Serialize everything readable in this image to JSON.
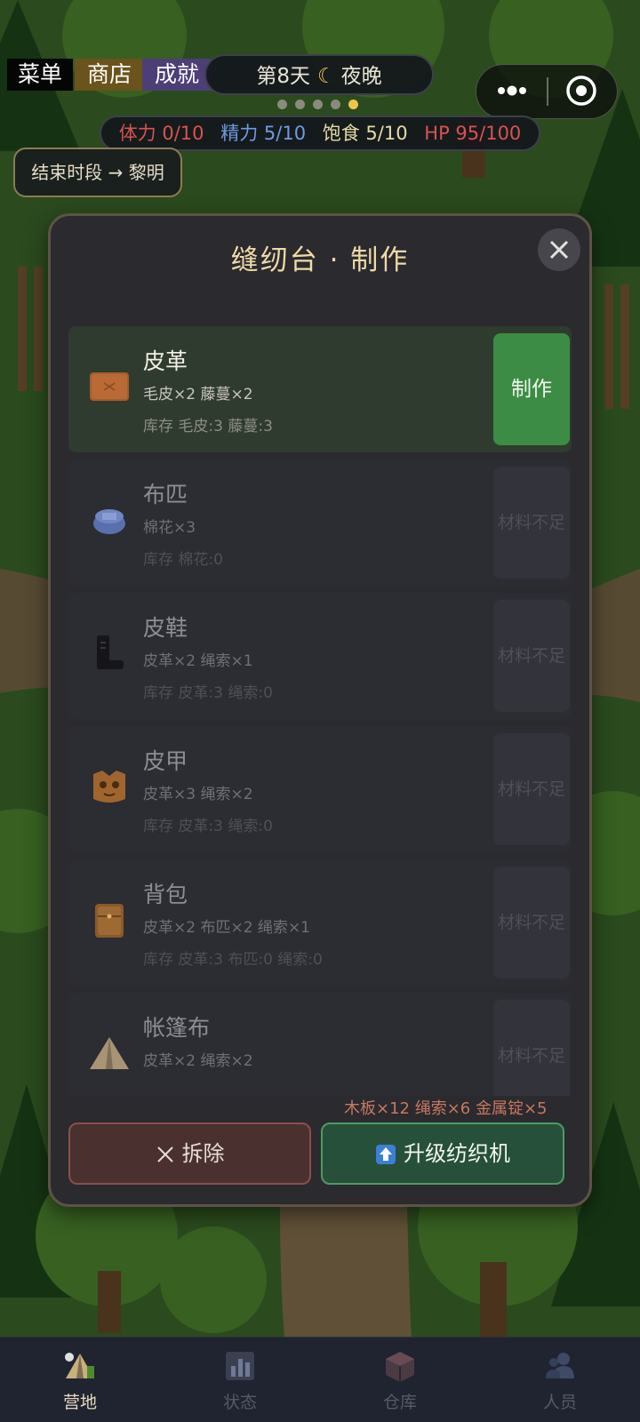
{
  "hud": {
    "menu_label": "菜单",
    "shop_label": "商店",
    "achievements_label": "成就",
    "day_label": "第8天",
    "time_of_day": "夜晚",
    "phase_dots_total": 5,
    "phase_dots_active_index": 4,
    "stats": {
      "stamina": "体力 0/10",
      "energy": "精力 5/10",
      "satiety": "饱食 5/10",
      "hp": "HP 95/100"
    },
    "end_period_label": "结束时段 → 黎明"
  },
  "modal": {
    "title": "缝纫台 · 制作",
    "recipes": [
      {
        "name": "皮革",
        "requires": "毛皮×2  藤蔓×2",
        "stock": "库存 毛皮:3  藤蔓:3",
        "action": "制作",
        "icon": "leather-icon",
        "craftable": true
      },
      {
        "name": "布匹",
        "requires": "棉花×3",
        "stock": "库存 棉花:0",
        "action": "材料不足",
        "icon": "cloth-icon",
        "craftable": false
      },
      {
        "name": "皮鞋",
        "requires": "皮革×2  绳索×1",
        "stock": "库存 皮革:3  绳索:0",
        "action": "材料不足",
        "icon": "boot-icon",
        "craftable": false
      },
      {
        "name": "皮甲",
        "requires": "皮革×3  绳索×2",
        "stock": "库存 皮革:3  绳索:0",
        "action": "材料不足",
        "icon": "armor-icon",
        "craftable": false
      },
      {
        "name": "背包",
        "requires": "皮革×2  布匹×2  绳索×1",
        "stock": "库存 皮革:3  布匹:0  绳索:0",
        "action": "材料不足",
        "icon": "backpack-icon",
        "craftable": false
      },
      {
        "name": "帐篷布",
        "requires": "皮革×2  绳索×2",
        "stock": "",
        "action": "材料不足",
        "icon": "tent-icon",
        "craftable": false
      }
    ],
    "upgrade_cost": "木板×12 绳索×6 金属锭×5",
    "dismantle_label": "拆除",
    "upgrade_label": "升级纺织机"
  },
  "tabbar": {
    "tabs": [
      {
        "label": "营地",
        "icon": "camp-icon",
        "active": true
      },
      {
        "label": "状态",
        "icon": "status-chart-icon",
        "active": false
      },
      {
        "label": "仓库",
        "icon": "warehouse-box-icon",
        "active": false
      },
      {
        "label": "人员",
        "icon": "people-icon",
        "active": false
      }
    ]
  },
  "colors": {
    "stamina": "#d9534f",
    "energy": "#6f9be0",
    "satiety": "#e8d9a8",
    "hp": "#d9534f",
    "craft_button": "#3d8c45",
    "title": "#efd9a6"
  }
}
